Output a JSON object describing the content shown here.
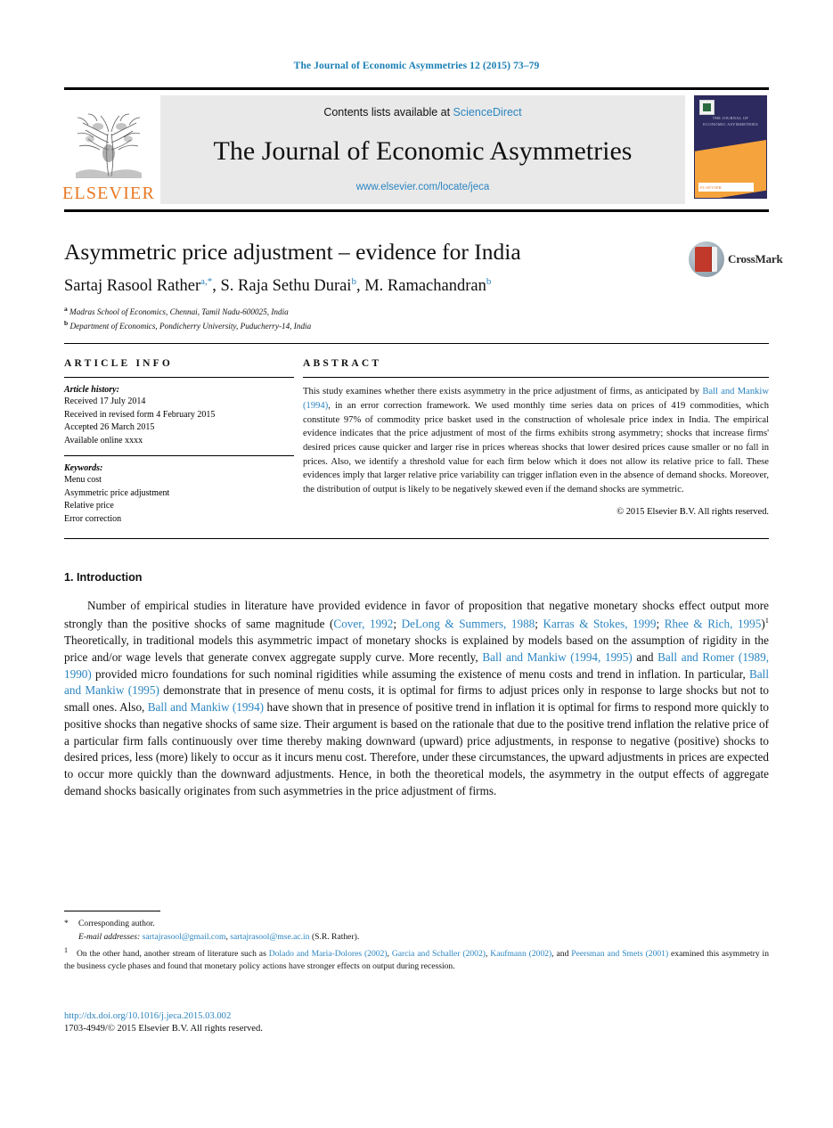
{
  "running_head": "The Journal of Economic Asymmetries 12 (2015) 73–79",
  "masthead": {
    "publisher_wordmark": "ELSEVIER",
    "contents_prefix": "Contents lists available at ",
    "contents_link": "ScienceDirect",
    "journal_title": "The Journal of Economic Asymmetries",
    "journal_url": "www.elsevier.com/locate/jeca",
    "cover_title_line1": "THE JOURNAL OF",
    "cover_title_line2": "ECONOMIC ASYMMETRIES",
    "cover_band_text": "ELSEVIER"
  },
  "article": {
    "title": "Asymmetric price adjustment – evidence for India",
    "authors_html": "Sartaj Rasool Rather<sup>a,*</sup>, S. Raja Sethu Durai<sup>b</sup>, M. Ramachandran<sup>b</sup>",
    "affiliation_a": "Madras School of Economics, Chennai, Tamil Nadu-600025, India",
    "affiliation_b": "Department of Economics, Pondicherry University, Puducherry-14, India",
    "crossmark_label": "CrossMark"
  },
  "info": {
    "heading": "ARTICLE INFO",
    "history_label": "Article history:",
    "history": [
      "Received 17 July 2014",
      "Received in revised form 4 February 2015",
      "Accepted 26 March 2015",
      "Available online xxxx"
    ],
    "keywords_label": "Keywords:",
    "keywords": [
      "Menu cost",
      "Asymmetric price adjustment",
      "Relative price",
      "Error correction"
    ]
  },
  "abstract": {
    "heading": "ABSTRACT",
    "part1": "This study examines whether there exists asymmetry in the price adjustment of firms, as anticipated by ",
    "citation": "Ball and Mankiw (1994)",
    "part2": ", in an error correction framework. We used monthly time series data on prices of 419 commodities, which constitute 97% of commodity price basket used in the construction of wholesale price index in India. The empirical evidence indicates that the price adjustment of most of the firms exhibits strong asymmetry; shocks that increase firms' desired prices cause quicker and larger rise in prices whereas shocks that lower desired prices cause smaller or no fall in prices. Also, we identify a threshold value for each firm below which it does not allow its relative price to fall. These evidences imply that larger relative price variability can trigger inflation even in the absence of demand shocks. Moreover, the distribution of output is likely to be negatively skewed even if the demand shocks are symmetric.",
    "copyright": "© 2015 Elsevier B.V. All rights reserved."
  },
  "introduction": {
    "heading": "1. Introduction",
    "p1_s1": "Number of empirical studies in literature have provided evidence in favor of proposition that negative monetary shocks effect output more strongly than the positive shocks of same magnitude (",
    "p1_c1": "Cover, 1992",
    "p1_c2": "DeLong & Summers, 1988",
    "p1_c3": "Karras & Stokes, 1999",
    "p1_c4": "Rhee & Rich, 1995",
    "p1_s2": "Theoretically, in traditional models this asymmetric impact of monetary shocks is explained by models based on the assumption of rigidity in the price and/or wage levels that generate convex aggregate supply curve. More recently, ",
    "p1_c5": "Ball and Mankiw (1994, 1995)",
    "p1_s3": " and ",
    "p1_c6": "Ball and Romer (1989, 1990)",
    "p1_s4": " provided micro foundations for such nominal rigidities while assuming the existence of menu costs and trend in inflation. In particular, ",
    "p1_c7": "Ball and Mankiw (1995)",
    "p1_s5": " demonstrate that in presence of menu costs, it is optimal for firms to adjust prices only in response to large shocks but not to small ones. Also, ",
    "p1_c8": "Ball and Mankiw (1994)",
    "p1_s6": " have shown that in presence of positive trend in inflation it is optimal for firms to respond more quickly to positive shocks than negative shocks of same size. Their argument is based on the rationale that due to the positive trend inflation the relative price of a particular firm falls continuously over time thereby making downward (upward) price adjustments, in response to negative (positive) shocks to desired prices, less (more) likely to occur as it incurs menu cost. Therefore, under these circumstances, the upward adjustments in prices are expected to occur more quickly than the downward adjustments. Hence, in both the theoretical models, the asymmetry in the output effects of aggregate demand shocks basically originates from such asymmetries in the price adjustment of firms."
  },
  "footnotes": {
    "corresponding_marker": "*",
    "corresponding_text": "Corresponding author.",
    "email_label": "E-mail addresses:",
    "email1": "sartajrasool@gmail.com",
    "email2": "sartajrasool@mse.ac.in",
    "email_suffix": "(S.R. Rather).",
    "fn1_marker": "1",
    "fn1_s1": "On the other hand, another stream of literature such as ",
    "fn1_c1": "Dolado and Maria-Dolores (2002)",
    "fn1_c2": "Garcia and Schaller (2002)",
    "fn1_c3": "Kaufmann (2002)",
    "fn1_c4": "Peersman and Smets (2001)",
    "fn1_s2": " examined this asymmetry in the business cycle phases and found that monetary policy actions have stronger effects on output during recession."
  },
  "footer": {
    "doi": "http://dx.doi.org/10.1016/j.jeca.2015.03.002",
    "issn_line": "1703-4949/© 2015 Elsevier B.V. All rights reserved."
  },
  "colors": {
    "link_blue": "#2b85c1",
    "elsevier_orange": "#E87722",
    "cover_navy": "#2c2a5e",
    "crossmark_red": "#c0392b"
  }
}
